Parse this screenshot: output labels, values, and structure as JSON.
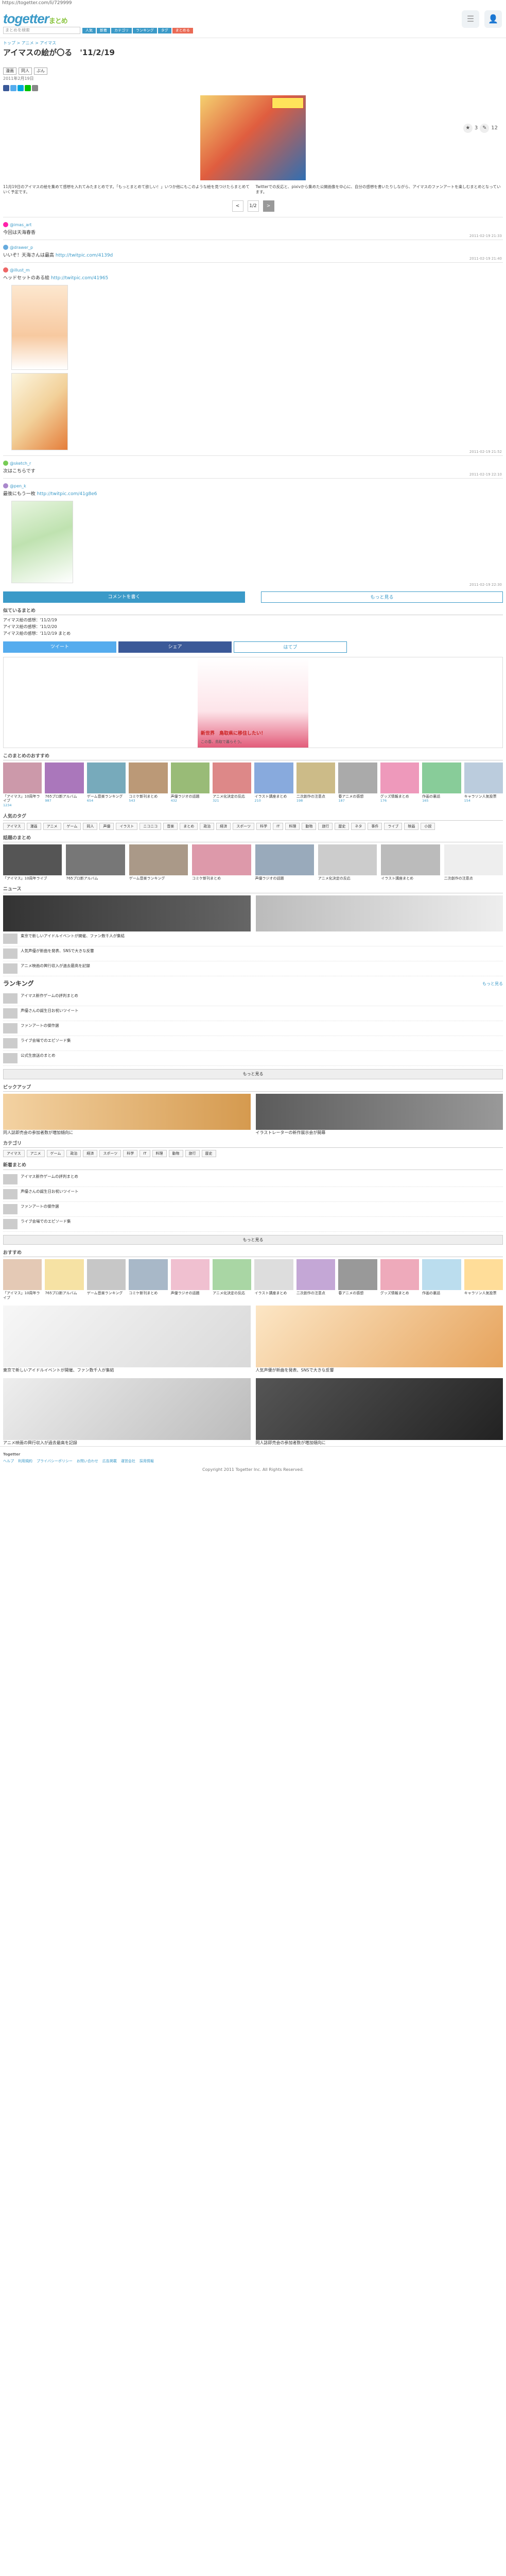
{
  "browser": {
    "url": "https://togetter.com/li/729999"
  },
  "header": {
    "logo": "togetter",
    "logo_sub": "まとめ",
    "search_placeholder": "まとめを検索",
    "nav": [
      "人気",
      "新着",
      "カテゴリ",
      "ランキング",
      "タグ",
      "まとめる"
    ],
    "icons": [
      "menu-icon",
      "user-icon",
      "bell-icon"
    ]
  },
  "topic": {
    "breadcrumb": "トップ > アニメ > アイマス",
    "title": "アイマスの絵が〇る　'11/2/19",
    "tags": [
      "漫画",
      "同人",
      "ぶん"
    ],
    "author": "2011年2月19日",
    "fav_count": "3",
    "comment_count": "12",
    "intro_left": "11月19日のアイマスの絵を集めて感想を入れてみたまとめです。「もっとまとめて欲しい！」いつか他にもこのような絵を見つけたらまとめていく予定です。",
    "intro_right": "Twitterでの反応と、pixivから集めた公開画像を中心に、自分の感想を書いたりしながら、アイマスのファンアートを楽しむまとめとなっています。"
  },
  "pager": {
    "prev": "<",
    "current": "1/2",
    "next": ">"
  },
  "posts": [
    {
      "num": "1",
      "name": "@imas_art",
      "text": "今回は天海春香",
      "url": "",
      "date": "2011-02-19 21:33"
    },
    {
      "num": "2",
      "name": "@drawer_p",
      "text": "いいぞ！天海さんは最高",
      "url": "http://twitpic.com/4139d",
      "date": "2011-02-19 21:40"
    },
    {
      "num": "3",
      "name": "@illust_m",
      "text": "ヘッドセットのある絵",
      "url": "http://twitpic.com/41965",
      "date": "2011-02-19 21:52"
    },
    {
      "num": "4",
      "name": "@sketch_r",
      "text": "次はこちらです",
      "url": "",
      "date": "2011-02-19 22:10"
    },
    {
      "num": "5",
      "name": "@pen_k",
      "text": "最後にもう一枚",
      "url": "http://twitpic.com/41g8e6",
      "date": "2011-02-19 22:30"
    }
  ],
  "comment": {
    "label": "コメントを書く",
    "more": "もっと見る"
  },
  "summary": [
    "アイマス絵の感想：'11/2/19",
    "アイマス絵の感想：'11/2/20",
    "アイマス絵の感想：'11/2/19 まとめ"
  ],
  "share": [
    "ツイート",
    "シェア",
    "はてブ"
  ],
  "ad": {
    "headline": "新世界　鳥取県に移住したい！",
    "body": "この春、鳥取で暮らそう。"
  },
  "sections": {
    "related": "このまとめのおすすめ",
    "popular_tags": "人気のタグ",
    "trending": "話題のまとめ",
    "news": "ニュース",
    "ranking": "ランキング",
    "category": "カテゴリ",
    "new": "新着まとめ",
    "pickup": "ピックアップ",
    "recommend": "おすすめ",
    "similar": "似ているまとめ",
    "footer": "Togetter"
  },
  "tags": [
    "アイマス",
    "漫画",
    "アニメ",
    "ゲーム",
    "同人",
    "声優",
    "イラスト",
    "ニコニコ",
    "音楽",
    "まとめ",
    "政治",
    "経済",
    "スポーツ",
    "科学",
    "IT",
    "料理",
    "動物",
    "旅行",
    "歴史",
    "ネタ",
    "事件",
    "ライブ",
    "映画",
    "小説"
  ],
  "cards": [
    {
      "title": "「アイマス」10周年ライブ",
      "count": "1234"
    },
    {
      "title": "765プロ新アルバム",
      "count": "987"
    },
    {
      "title": "ゲーム音楽ランキング",
      "count": "654"
    },
    {
      "title": "コミケ新刊まとめ",
      "count": "543"
    },
    {
      "title": "声優ラジオの話題",
      "count": "432"
    },
    {
      "title": "アニメ化決定の反応",
      "count": "321"
    },
    {
      "title": "イラスト講座まとめ",
      "count": "210"
    },
    {
      "title": "二次創作の注意点",
      "count": "198"
    },
    {
      "title": "春アニメの感想",
      "count": "187"
    },
    {
      "title": "グッズ情報まとめ",
      "count": "176"
    },
    {
      "title": "作画の裏話",
      "count": "165"
    },
    {
      "title": "キャラソン人気投票",
      "count": "154"
    }
  ],
  "news": [
    "東京で新しいアイドルイベントが開催、ファン数千人が集結",
    "人気声優が新曲を発表、SNSで大きな反響",
    "アニメ映画の興行収入が過去最高を記録",
    "同人誌即売会の参加者数が増加傾向に",
    "イラストレーターの新作展示会が開幕"
  ],
  "ranking_items": [
    "アイマス新作ゲームの評判まとめ",
    "声優さんの誕生日お祝いツイート",
    "ファンアートの傑作選",
    "ライブ会場でのエピソード集",
    "公式生放送のまとめ"
  ],
  "footer": {
    "links": [
      "ヘルプ",
      "利用規約",
      "プライバシーポリシー",
      "お問い合わせ",
      "広告掲載",
      "運営会社",
      "採用情報"
    ],
    "copyright": "Copyright 2011 Togetter Inc. All Rights Reserved."
  }
}
